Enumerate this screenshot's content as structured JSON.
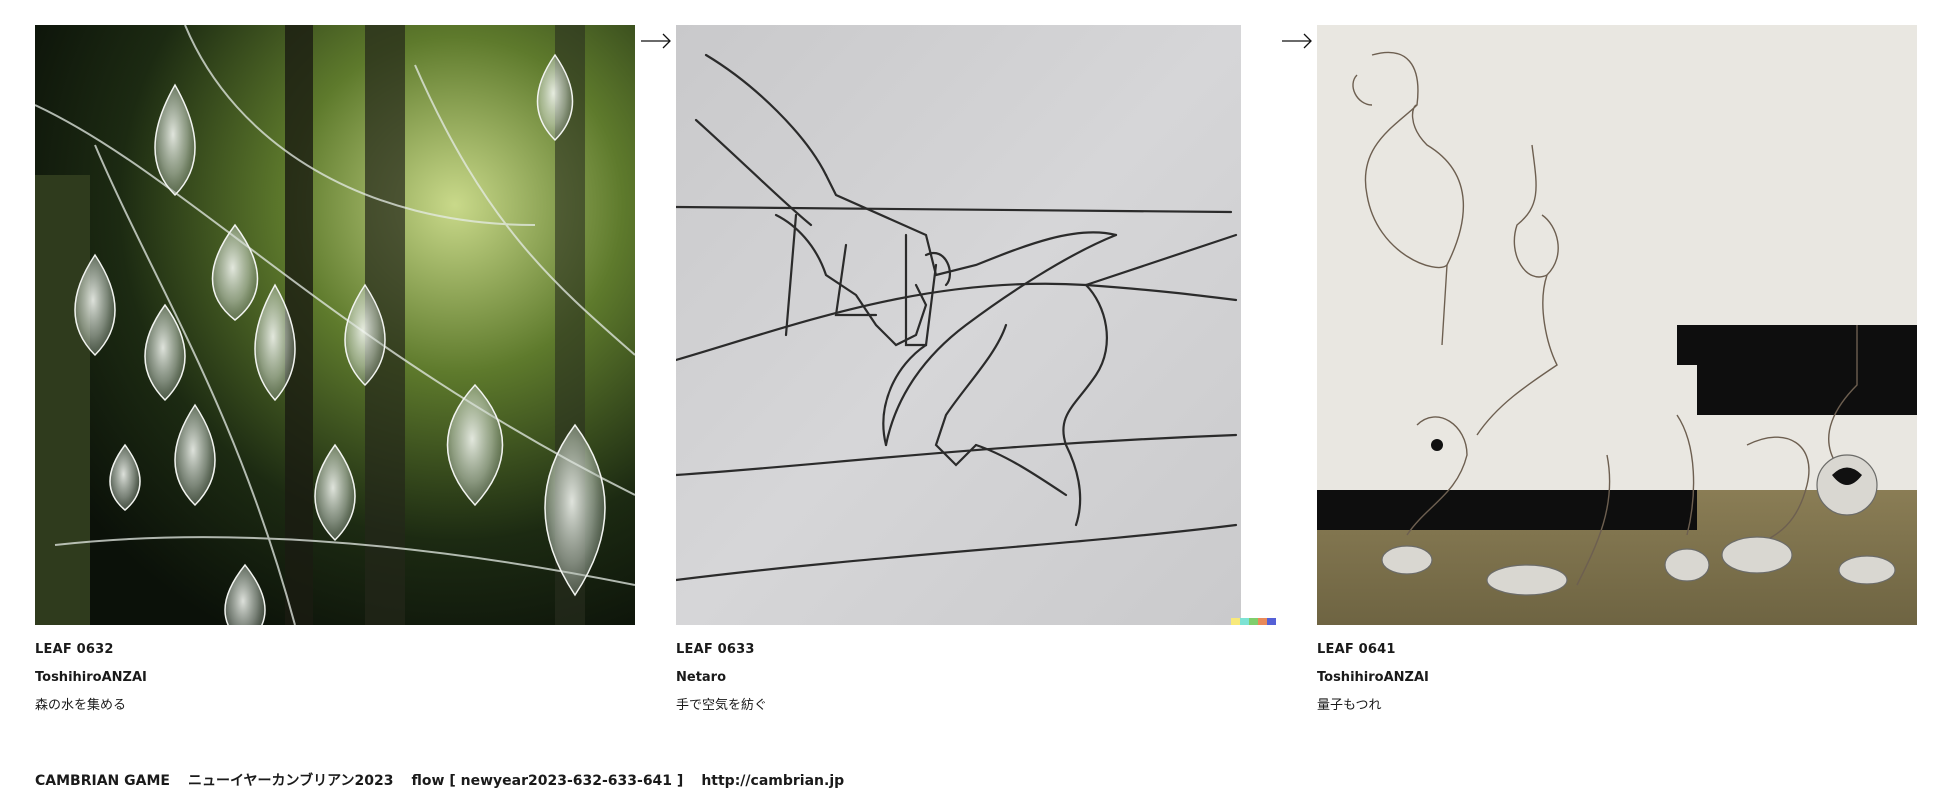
{
  "cards": [
    {
      "id": "LEAF 0632",
      "author": "ToshihiroANZAI",
      "title": "森の水を集める",
      "image_icon": "forest-glass-drops-image"
    },
    {
      "id": "LEAF 0633",
      "author": "Netaro",
      "title": "手で空気を紡ぐ",
      "image_icon": "hand-line-drawing-image"
    },
    {
      "id": "LEAF 0641",
      "author": "ToshihiroANZAI",
      "title": "量子もつれ",
      "image_icon": "surreal-wire-figures-image"
    }
  ],
  "arrow_icon": "right-arrow-icon",
  "footer": {
    "game": "CAMBRIAN GAME",
    "event": "ニューイヤーカンブリアン2023",
    "flow": "flow [ newyear2023-632-633-641 ]",
    "url": "http://cambrian.jp"
  }
}
